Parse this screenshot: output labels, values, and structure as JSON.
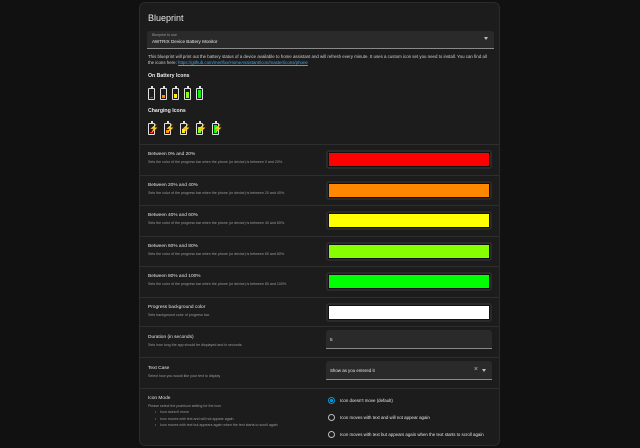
{
  "card": {
    "title": "Blueprint",
    "blueprint_select": {
      "label": "Blueprint to use",
      "value": "AWTRIX Device Battery Monitor"
    },
    "description": "This blueprint will print out the battery status of a device available to home assistant and will refresh every minute. It uses a custom icon set you need to install. You can find all the icons here: ",
    "description_link": "https://github.com/merlfox/HomeAssistant/icon/master/icons/phone",
    "on_battery_heading": "On Battery Icons",
    "charging_heading": "Charging Icons",
    "battery_levels": [
      0.15,
      0.35,
      0.55,
      0.75,
      0.95
    ],
    "battery_colors": [
      "#ff1a1a",
      "#ff8c00",
      "#ffee00",
      "#88ff11",
      "#11ee11"
    ],
    "bolt_color": "#f2c200"
  },
  "rows": [
    {
      "title": "Between 0% and 20%",
      "desc": "Sets the color of the progress bar when the phone (or device) is between 0 and 20%.",
      "color": "#ff0000"
    },
    {
      "title": "Between 20% and 40%",
      "desc": "Sets the color of the progress bar when the phone (or device) is between 20 and 40%.",
      "color": "#ff8800"
    },
    {
      "title": "Between 40% and 60%",
      "desc": "Sets the color of the progress bar when the phone (or device) is between 40 and 60%.",
      "color": "#ffff00"
    },
    {
      "title": "Between 60% and 80%",
      "desc": "Sets the color of the progress bar when the phone (or device) is between 60 and 80%.",
      "color": "#88ff00"
    },
    {
      "title": "Between 80% and 100%",
      "desc": "Sets the color of the progress bar when the phone (or device) is between 80 and 100%.",
      "color": "#00ff00"
    },
    {
      "title": "Progress background color",
      "desc": "Sets background color of progress bar.",
      "color": "#ffffff"
    }
  ],
  "duration": {
    "title": "Duration (in seconds)",
    "desc": "Sets how long the app should be displayed and in seconds.",
    "value": "5"
  },
  "text_case": {
    "title": "Text Case",
    "desc": "Select how you would like your text to display",
    "value": "Show as you entered it",
    "clear_icon": "close-icon"
  },
  "icon_mode": {
    "title": "Icon Mode",
    "desc": "Please select the pushicon setting for the icon",
    "bullets": [
      "Icon doesn't move",
      "Icon moves with text and will not appear again",
      "Icon moves with text but appears again when the text starts to scroll again"
    ],
    "options": [
      "Icon doesn't move (default)",
      "Icon moves with text and will not appear again",
      "Icon moves with text but appears again when the text starts to scroll again"
    ],
    "selected_index": 0,
    "accent": "#039be5"
  }
}
